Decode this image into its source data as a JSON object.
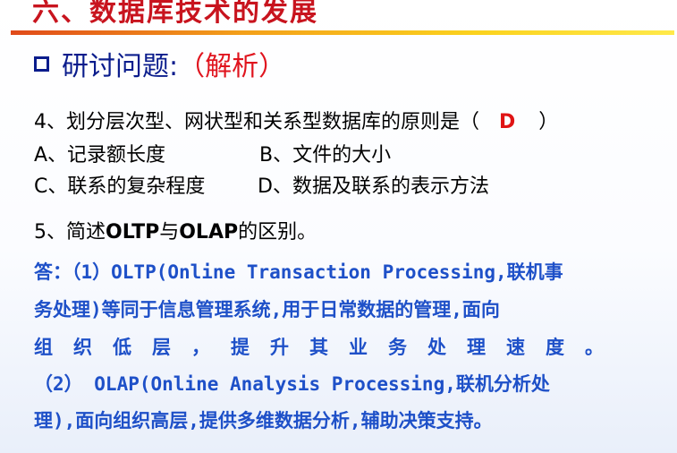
{
  "slide": {
    "title": "六、数据库技术的发展"
  },
  "section": {
    "label": "研讨问题:",
    "analysis": "（解析）"
  },
  "question4": {
    "text": "4、划分层次型、网状型和关系型数据库的原则是（",
    "answer": "D",
    "close": "）",
    "options": {
      "A": "A、记录额长度",
      "B": "B、文件的大小",
      "C": "C、联系的复杂程度",
      "D": "D、数据及联系的表示方法"
    }
  },
  "question5": {
    "prefix": "5、简述",
    "oltp": "OLTP",
    "mid": "与",
    "olap": "OLAP",
    "suffix": "的区别。"
  },
  "answer": {
    "lines": [
      "答：（1）OLTP(Online Transaction Processing,联机事",
      "务处理)等同于信息管理系统,用于日常数据的管理,面向",
      "组织低层，提升其业务处理速度。",
      "（2） OLAP(Online Analysis Processing,联机分析处",
      "理),面向组织高层,提供多维数据分析,辅助决策支持。"
    ]
  }
}
